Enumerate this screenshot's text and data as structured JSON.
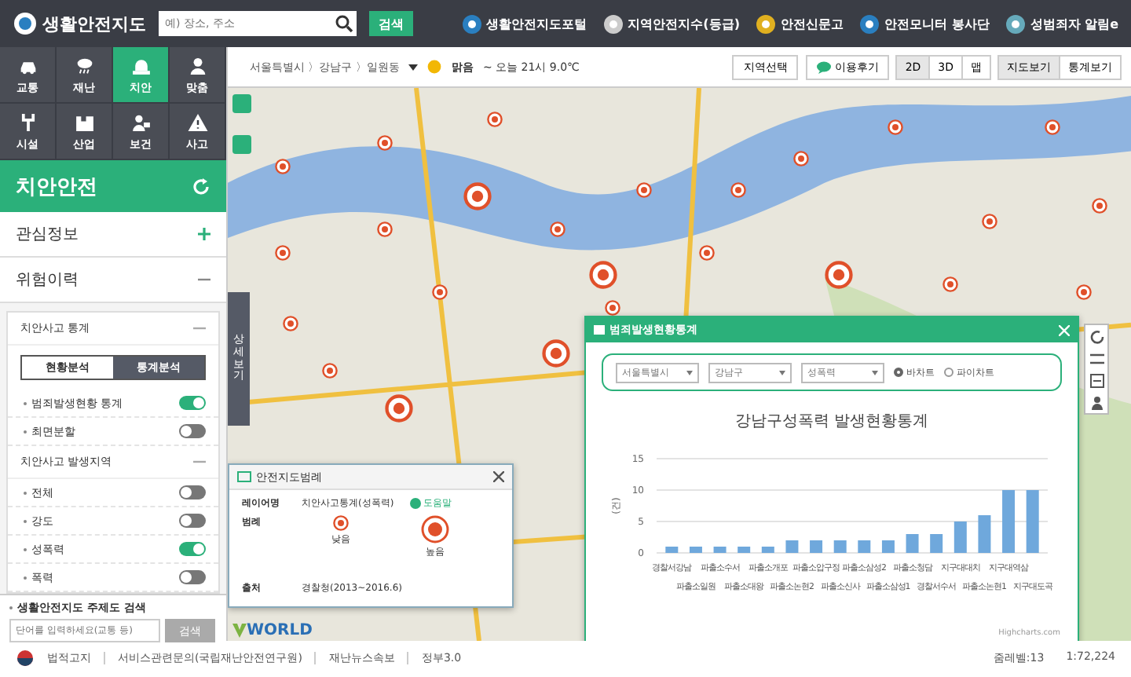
{
  "header": {
    "logo": "생활안전지도",
    "search": {
      "placeholder": "예) 장소, 주소"
    },
    "search_button": "검색",
    "links": [
      {
        "label": "생활안전지도포털"
      },
      {
        "label": "지역안전지수(등급)"
      },
      {
        "label": "안전신문고"
      },
      {
        "label": "안전모니터 봉사단"
      },
      {
        "label": "성범죄자 알림e"
      }
    ]
  },
  "categories": [
    {
      "label": "교통",
      "selected": false
    },
    {
      "label": "재난",
      "selected": false
    },
    {
      "label": "치안",
      "selected": true
    },
    {
      "label": "맞춤",
      "selected": false
    },
    {
      "label": "시설",
      "selected": false
    },
    {
      "label": "산업",
      "selected": false
    },
    {
      "label": "보건",
      "selected": false
    },
    {
      "label": "사고",
      "selected": false
    }
  ],
  "panel": {
    "title": "치안안전",
    "sections": [
      {
        "label": "관심정보",
        "expanded": false
      },
      {
        "label": "위험이력",
        "expanded": true
      }
    ]
  },
  "stats": {
    "title": "치안사고 통계",
    "expanded": true,
    "tabs": [
      {
        "label": "현황분석",
        "selected": false
      },
      {
        "label": "통계분석",
        "selected": true
      }
    ],
    "toggles": [
      {
        "label": "범죄발생현황 통계",
        "on": true
      },
      {
        "label": "최면분할",
        "on": false
      }
    ]
  },
  "area": {
    "title": "치안사고 발생지역",
    "expanded": true,
    "toggles": [
      {
        "label": "전체",
        "on": false
      },
      {
        "label": "강도",
        "on": false
      },
      {
        "label": "성폭력",
        "on": true
      },
      {
        "label": "폭력",
        "on": false
      }
    ]
  },
  "theme_search": {
    "label": "생활안전지도 주제도 검색",
    "placeholder": "단어를 입력하세요(교통 등)",
    "button": "검색"
  },
  "map_toolbar": {
    "breadcrumb": "서울특별시 〉강남구 〉일원동",
    "weather": "맑음",
    "forecast": "~ 오늘 21시 9.0℃",
    "region_button": "지역선택",
    "review_button": "이용후기",
    "modes": [
      {
        "label": "2D",
        "selected": true
      },
      {
        "label": "3D",
        "selected": false
      },
      {
        "label": "맵",
        "selected": false
      }
    ],
    "views": [
      {
        "label": "지도보기",
        "selected": true
      },
      {
        "label": "통계보기",
        "selected": false
      }
    ]
  },
  "side_tab": "상세보기",
  "legend": {
    "title": "안전지도범례",
    "layer_label": "레이어명",
    "layer": "치안사고통계(성폭력)",
    "help": "도움말",
    "legend_label": "범례",
    "low": "낮음",
    "high": "높음",
    "source_label": "출처",
    "source": "경찰청(2013~2016.6)"
  },
  "map_logo": "WORLD",
  "stats_window": {
    "title": "범죄발생현황통계",
    "selects": [
      {
        "value": "서울특별시"
      },
      {
        "value": "강남구"
      },
      {
        "value": "성폭력"
      }
    ],
    "chart_types": [
      {
        "label": "바차트",
        "selected": true
      },
      {
        "label": "파이차트",
        "selected": false
      }
    ],
    "chart_data": {
      "type": "bar",
      "title": "강남구성폭력 발생현황통계",
      "ylabel": "(건)",
      "categories": [
        "경찰서강남",
        "파출소일원",
        "파출소수서",
        "파출소대왕",
        "파출소개포",
        "파출소논현2",
        "파출소압구정",
        "파출소신사",
        "파출소삼성2",
        "파출소삼성1",
        "파출소청담",
        "경찰서수서",
        "지구대대치",
        "파출소논현1",
        "지구대역삼",
        "지구대도곡"
      ],
      "series": [
        {
          "color": "#6fa8dc",
          "values": [
            1,
            1,
            1,
            1,
            1,
            2,
            2,
            2,
            2,
            2,
            3,
            3,
            5,
            6,
            10,
            10
          ]
        }
      ],
      "ylim": [
        0,
        15
      ],
      "yticks": [
        0,
        5,
        10,
        15
      ]
    },
    "credit": "Highcharts.com"
  },
  "footer": {
    "links": [
      {
        "label": "법적고지"
      },
      {
        "label": "서비스관련문의(국립재난안전연구원)"
      },
      {
        "label": "재난뉴스속보"
      },
      {
        "label": "정부3.0"
      }
    ],
    "zoom": "줌레벨:13",
    "scale": "1:72,224"
  }
}
